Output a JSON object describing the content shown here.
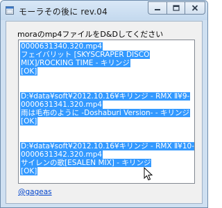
{
  "window": {
    "title": "モーラその後に rev.04",
    "icon": "app-window-icon",
    "controls": [
      {
        "name": "minimize-icon"
      },
      {
        "name": "maximize-icon"
      },
      {
        "name": "close-icon"
      }
    ]
  },
  "main": {
    "instruction": "moraのmp4ファイルをD&Dしてください",
    "results": [
      {
        "lines": [
          "0000631340.320.mp4",
          "  フェイバリット [SKYSCRAPER DISCO",
          "MIX]/ROCKING TIME - キリンジ",
          "[OK]"
        ]
      },
      {
        "lines": [
          "D:¥data¥soft¥2012.10.16¥キリンジ - RMX Ⅱ¥9-",
          "0000631341.320.mp4",
          "  雨は毛布のように -Doshaburi Version- - キリンジ",
          "[OK]"
        ]
      },
      {
        "lines": [
          "D:¥data¥soft¥2012.10.16¥キリンジ - RMX Ⅱ¥10-",
          "0000631342.320.mp4",
          "  サイレンの歌[ESALEN MIX] - キリンジ",
          "[OK]"
        ]
      }
    ],
    "link": "@gageas"
  },
  "colors": {
    "selection": "#3399ff",
    "link": "#0044cc",
    "frame": "#cfe0f1"
  }
}
